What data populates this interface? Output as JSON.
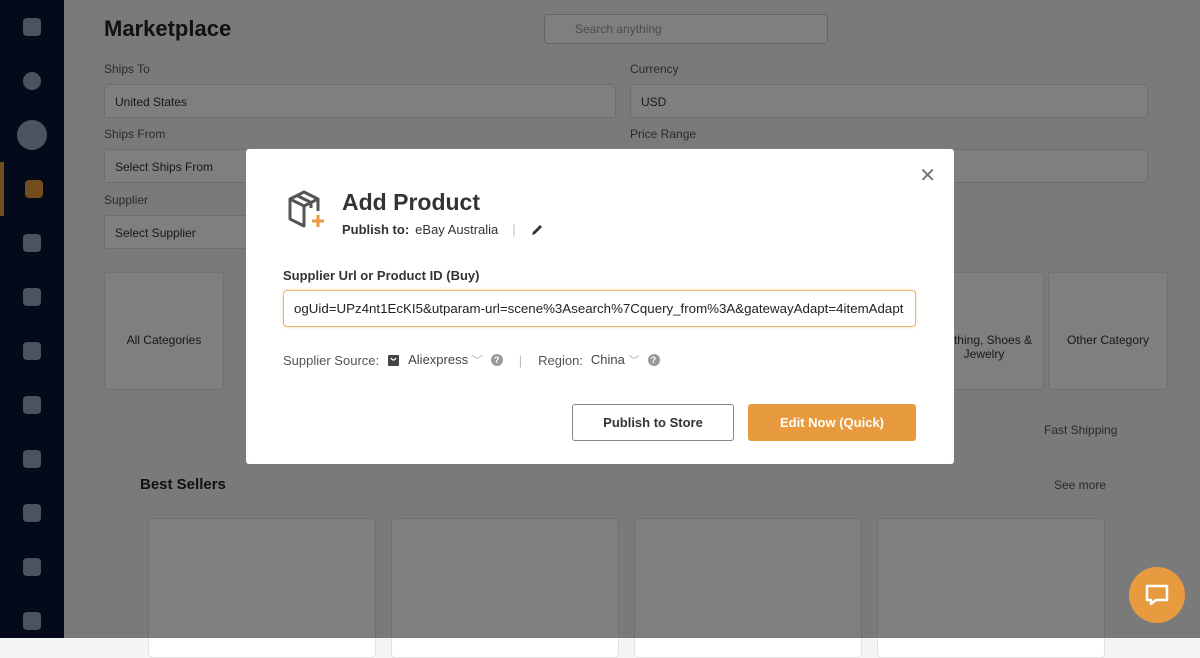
{
  "background": {
    "title": "Marketplace",
    "search_placeholder": "Search anything",
    "ships_to_label": "Ships To",
    "ships_to_value": "United States",
    "currency_label": "Currency",
    "currency_value": "USD",
    "ships_from_label": "Ships From",
    "ships_from_value": "Select Ships From",
    "price_range_label": "Price Range",
    "supplier_label": "Supplier",
    "supplier_value": "Select Supplier",
    "categories": [
      "All Categories",
      "Clothing, Shoes & Jewelry",
      "Other Category"
    ],
    "fast_shipping": "Fast Shipping",
    "best_sellers": "Best Sellers",
    "see_more": "See more"
  },
  "modal": {
    "title": "Add Product",
    "publish_to_label": "Publish to:",
    "publish_to_value": "eBay Australia",
    "field_label": "Supplier Url or Product ID (Buy)",
    "url_value": "ogUid=UPz4nt1EcKI5&utparam-url=scene%3Asearch%7Cquery_from%3A&gatewayAdapt=4itemAdapt",
    "supplier_source_label": "Supplier Source:",
    "supplier_source_value": "Aliexpress",
    "region_label": "Region:",
    "region_value": "China",
    "publish_button": "Publish to Store",
    "edit_button": "Edit Now (Quick)"
  },
  "colors": {
    "accent": "#e89b3e",
    "sidebar": "#0b1536"
  }
}
